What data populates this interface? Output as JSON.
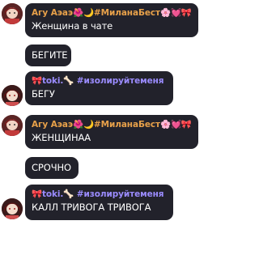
{
  "colors": {
    "bubble_bg": "#22222b",
    "sender_orange": "#e8a14a",
    "sender_purple": "#9b8cff",
    "text": "#ffffff"
  },
  "messages": [
    {
      "sender": "Агу Аэаэ🌺🌙#МиланаБест🌸💓🎀",
      "text": "Женщина в чате"
    },
    {
      "sender": "",
      "text": "БЕГИТЕ"
    },
    {
      "sender": "🎀toki.🦴 #изолируйтеменя",
      "text": "БЕГУ"
    },
    {
      "sender": "Агу Аэаэ🌺🌙#МиланаБест🌸💓🎀",
      "text": "ЖЕНЩИНАА"
    },
    {
      "sender": "",
      "text": "СРОЧНО"
    },
    {
      "sender": "🎀toki.🦴 #изолируйтеменя",
      "text": "КАЛЛ ТРИВОГА ТРИВОГА"
    }
  ]
}
